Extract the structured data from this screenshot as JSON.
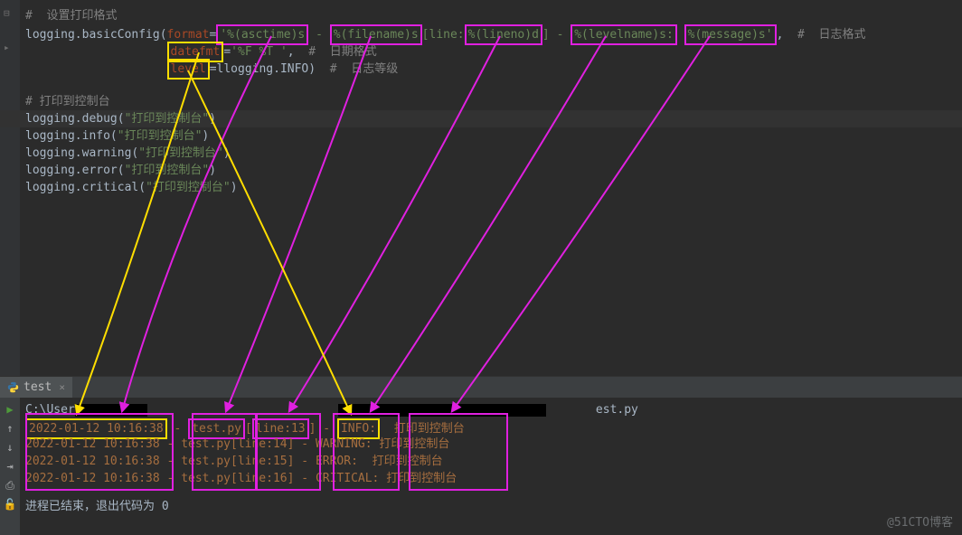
{
  "editor": {
    "comment_set_format": "#  设置打印格式",
    "line2_prefix": "logging.basicConfig(",
    "param_format": "format",
    "fmt_asctime": "'%(asctime)s",
    "fmt_sep": " - ",
    "fmt_filename": "%(filename)s",
    "fmt_line_literal": "[line:",
    "fmt_lineno": "%(lineno)d",
    "fmt_close_bracket": "] - ",
    "fmt_levelname": "%(levelname)s:",
    "fmt_message": "%(message)s'",
    "comment_log_format": "#  日志格式",
    "param_datefmt": "datefmt",
    "datefmt_val": "'%F %T '",
    "comment_date_format": "#  日期格式",
    "param_level": "level",
    "level_val": "logging.INFO)",
    "comment_log_level": "#  日志等级",
    "comment_print_console": "# 打印到控制台",
    "log_debug": "logging.debug(",
    "log_info": "logging.info(",
    "log_warning": "logging.warning(",
    "log_error": "logging.error(",
    "log_critical": "logging.critical(",
    "log_msg": "\"打印到控制台\"",
    "close_paren": ")"
  },
  "tab": {
    "name": "test"
  },
  "console": {
    "first_line_prefix": "C:\\User",
    "first_line_suffix": "est.py",
    "rows": [
      {
        "ts": "2022-01-12 10:16:38",
        "file": "test.py",
        "linetxt": "line:13",
        "level": "INFO:",
        "msg": "打印到控制台"
      },
      {
        "ts": "2022-01-12 10:16:38",
        "file": "test.py",
        "linetxt": "line:14",
        "level": "WARNING:",
        "msg": "打印到控制台"
      },
      {
        "ts": "2022-01-12 10:16:38",
        "file": "test.py",
        "linetxt": "line:15",
        "level": "ERROR:",
        "msg": "打印到控制台"
      },
      {
        "ts": "2022-01-12 10:16:38",
        "file": "test.py",
        "linetxt": "line:16",
        "level": "CRITICAL:",
        "msg": "打印到控制台"
      }
    ],
    "exit_line": "进程已结束，退出代码为 0"
  },
  "watermark": "@51CTO博客"
}
